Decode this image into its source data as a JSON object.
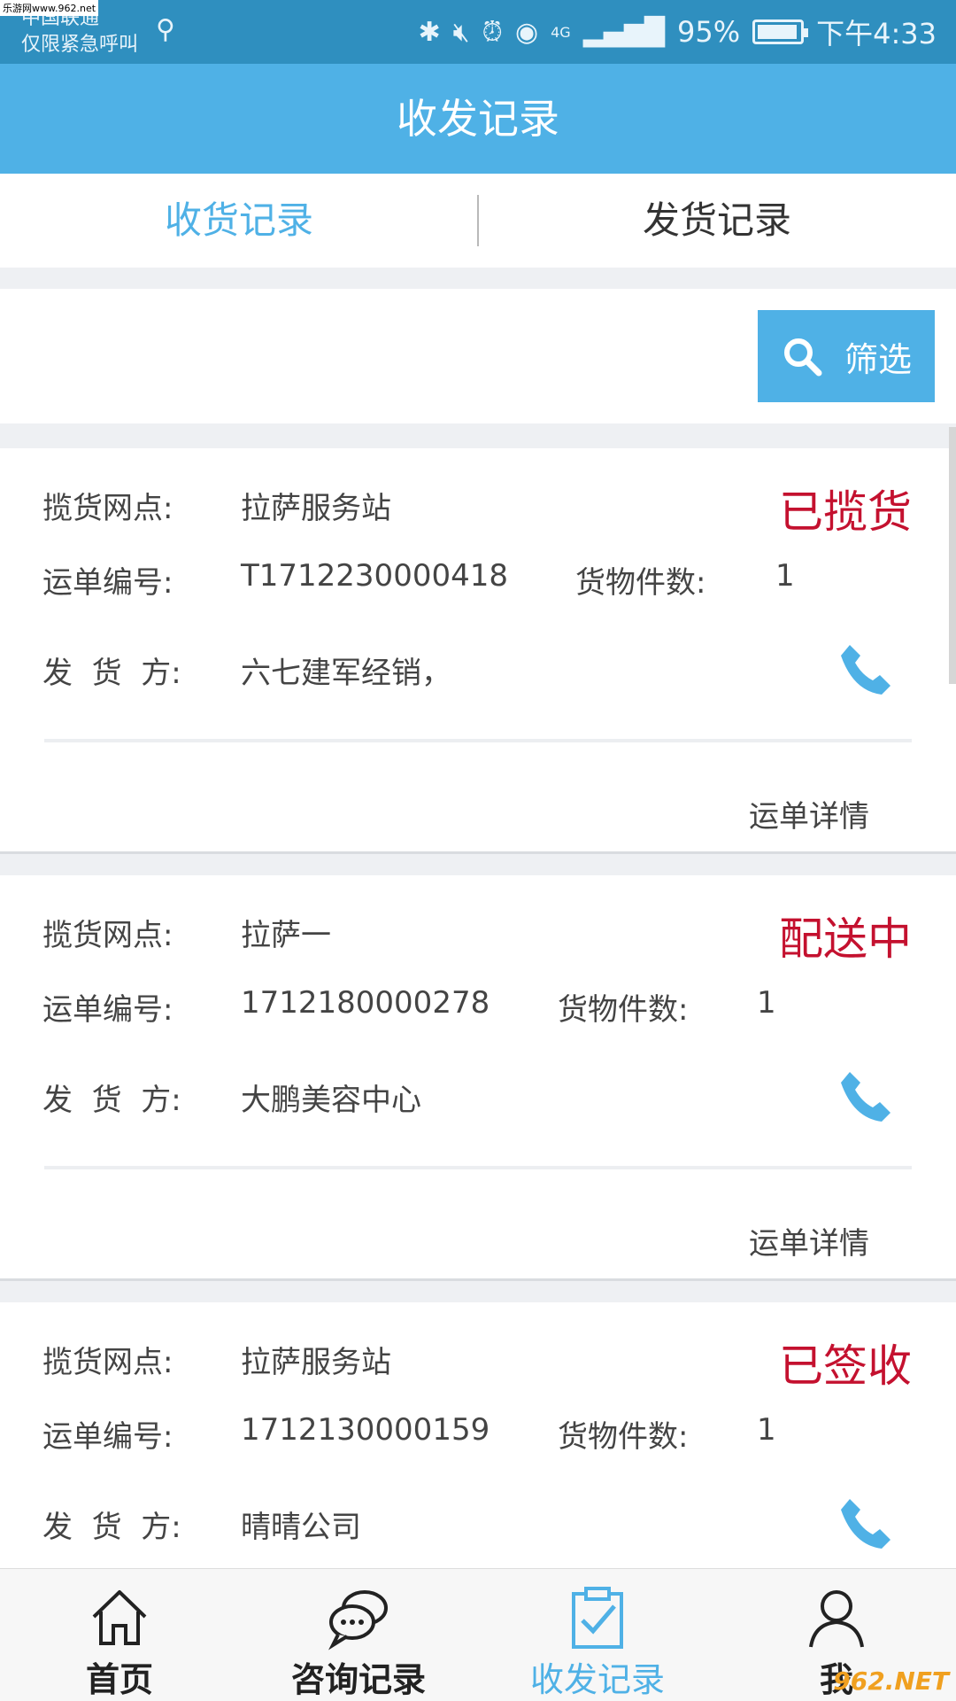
{
  "watermark_top": "乐游网www.962.net",
  "status_bar": {
    "carrier": "中国联通",
    "emergency": "仅限紧急呼叫",
    "battery": "95%",
    "time": "下午4:33",
    "network": "4G"
  },
  "header": {
    "title": "收发记录"
  },
  "tabs": [
    {
      "label": "收货记录",
      "active": true
    },
    {
      "label": "发货记录",
      "active": false
    }
  ],
  "filter": {
    "label": "筛选"
  },
  "labels": {
    "pickup_point": "揽货网点:",
    "waybill_no": "运单编号:",
    "pieces": "货物件数:",
    "shipper": "发  货  方:",
    "detail": "运单详情"
  },
  "records": [
    {
      "pickup_point": "拉萨服务站",
      "status": "已揽货",
      "waybill_no": "T1712230000418",
      "pieces": "1",
      "shipper": "六七建军经销，"
    },
    {
      "pickup_point": "拉萨一",
      "status": "配送中",
      "waybill_no": "1712180000278",
      "pieces": "1",
      "shipper": "大鹏美容中心"
    },
    {
      "pickup_point": "拉萨服务站",
      "status": "已签收",
      "waybill_no": "1712130000159",
      "pieces": "1",
      "shipper": "晴晴公司"
    }
  ],
  "bottom_nav": [
    {
      "label": "首页",
      "icon": "home-icon"
    },
    {
      "label": "咨询记录",
      "icon": "chat-icon"
    },
    {
      "label": "收发记录",
      "icon": "clipboard-check-icon",
      "active": true
    },
    {
      "label": "我",
      "icon": "user-icon"
    }
  ],
  "watermark_bottom": "962.NET",
  "colors": {
    "accent": "#4fb1e6",
    "status": "#c4112f",
    "statusbar": "#2f8fbf"
  }
}
